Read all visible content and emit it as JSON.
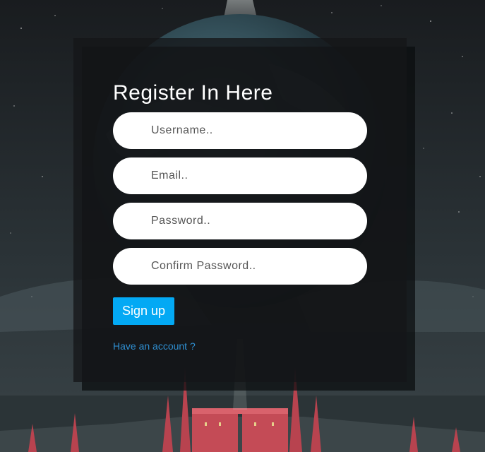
{
  "form": {
    "title": "Register In Here",
    "username_placeholder": "Username..",
    "email_placeholder": "Email..",
    "password_placeholder": "Password..",
    "confirm_placeholder": "Confirm Password..",
    "signup_label": "Sign up",
    "account_link": "Have an account ?"
  },
  "colors": {
    "button": "#03a9f4",
    "link": "#2f8fd1",
    "panel": "#141618",
    "field": "#ffffff"
  }
}
